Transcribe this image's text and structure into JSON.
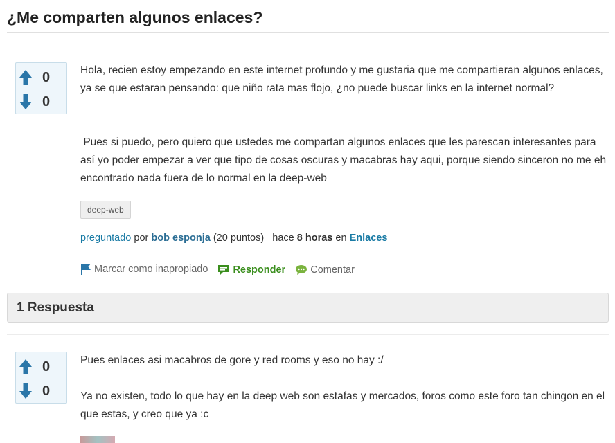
{
  "question": {
    "title": "¿Me comparten algunos enlaces?",
    "votes": {
      "up": "0",
      "down": "0"
    },
    "paragraphs": [
      "Hola, recien estoy empezando en este internet profundo y me gustaria que me compartieran algunos enlaces, ya se que estaran pensando: que niño rata mas flojo, ¿no puede buscar links en la internet normal?",
      " Pues si puedo, pero quiero que ustedes me compartan algunos enlaces que les parescan interesantes para así yo poder empezar a ver que tipo de cosas oscuras y macabras hay aqui, porque siendo sinceron no me eh encontrado nada fuera de lo normal en la deep-web"
    ],
    "tags": [
      "deep-web"
    ],
    "meta": {
      "asked": "preguntado",
      "by": "por",
      "user": "bob esponja",
      "points": "(20 puntos)",
      "ago_prefix": "hace",
      "ago_value": "8 horas",
      "in": "en",
      "category": "Enlaces"
    },
    "actions": {
      "flag": "Marcar como inapropiado",
      "answer": "Responder",
      "comment": "Comentar"
    }
  },
  "answers_header": "1 Respuesta",
  "answer": {
    "votes": {
      "up": "0",
      "down": "0"
    },
    "paragraphs": [
      "Pues enlaces asi macabros de gore y red rooms y eso no hay :/",
      "Ya no existen, todo lo que hay en la deep web son estafas y mercados, foros como este foro tan chingon en el que estas, y creo que ya :c"
    ]
  },
  "colors": {
    "accent": "#1a7ba5",
    "vote_arrow": "#2a76a8",
    "answer_green": "#3a8e1d"
  }
}
